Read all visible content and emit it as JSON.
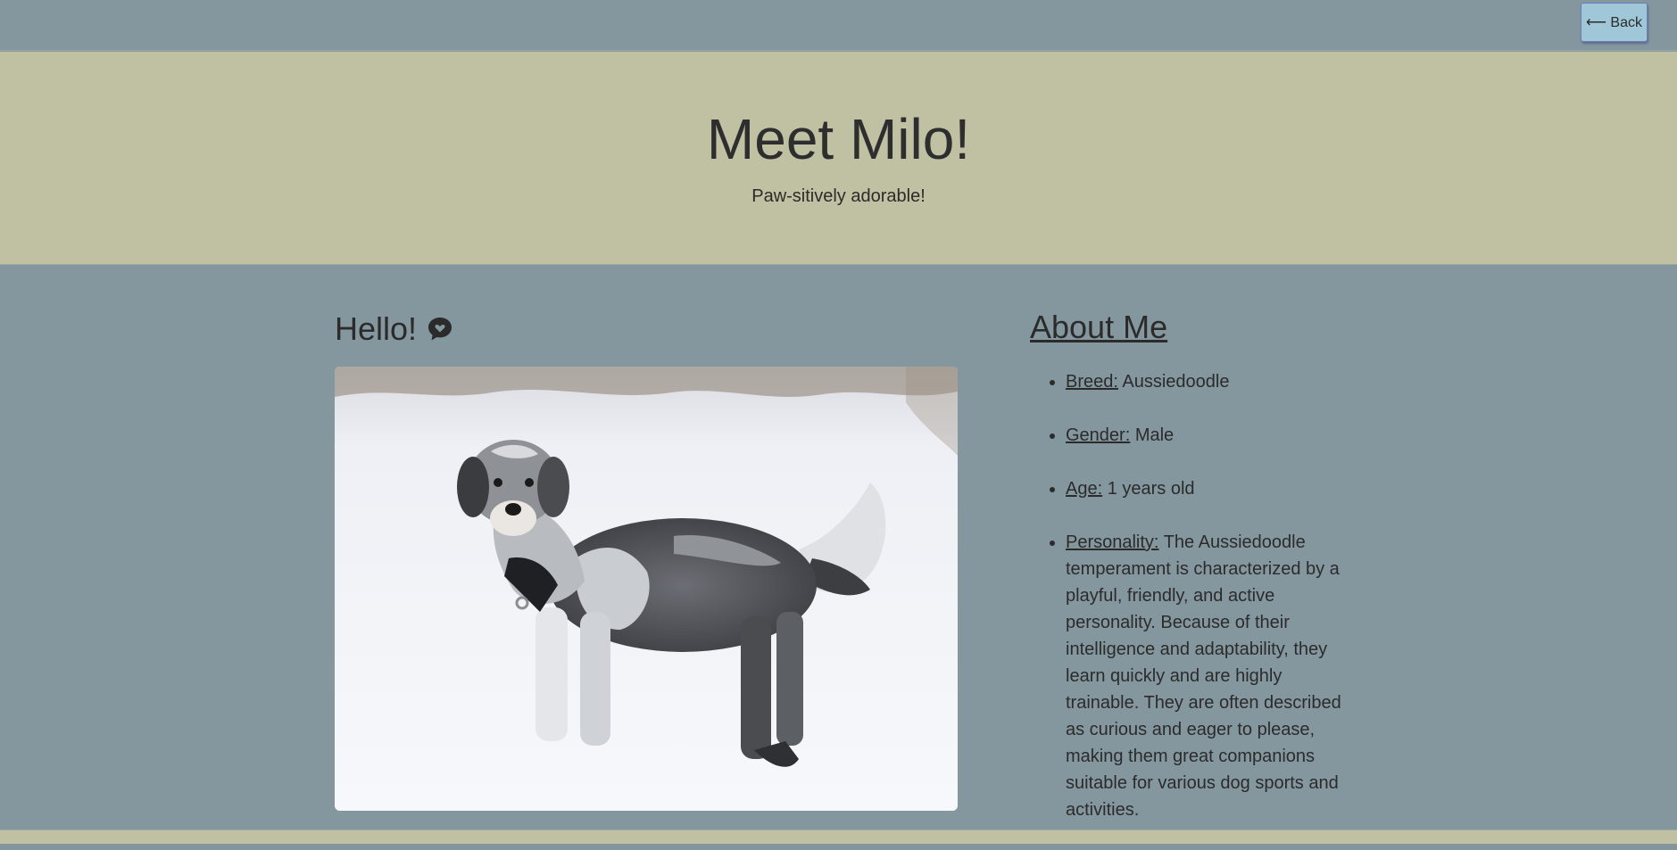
{
  "nav": {
    "back_label": "⟵ Back"
  },
  "hero": {
    "title": "Meet Milo!",
    "subtitle": "Paw-sitively adorable!"
  },
  "greeting": {
    "heading": "Hello!",
    "icon": "chat-bubble-heart-icon"
  },
  "photo": {
    "subject": "dog-photo"
  },
  "about": {
    "heading": "About Me",
    "items": [
      {
        "label": "Breed:",
        "value": "Aussiedoodle"
      },
      {
        "label": "Gender:",
        "value": "Male"
      },
      {
        "label": "Age:",
        "value": "1 years old"
      },
      {
        "label": "Personality:",
        "value": "The Aussiedoodle temperament is characterized by a playful, friendly, and active personality. Because of their intelligence and adaptability, they learn quickly and are highly trainable. They are often described as curious and eager to please, making them great companions suitable for various dog sports and activities."
      }
    ]
  },
  "colors": {
    "page_bg": "#84979e",
    "hero_bg": "#bfc1a2",
    "button_bg": "#9fc7d8",
    "text": "#2b2b2b"
  }
}
